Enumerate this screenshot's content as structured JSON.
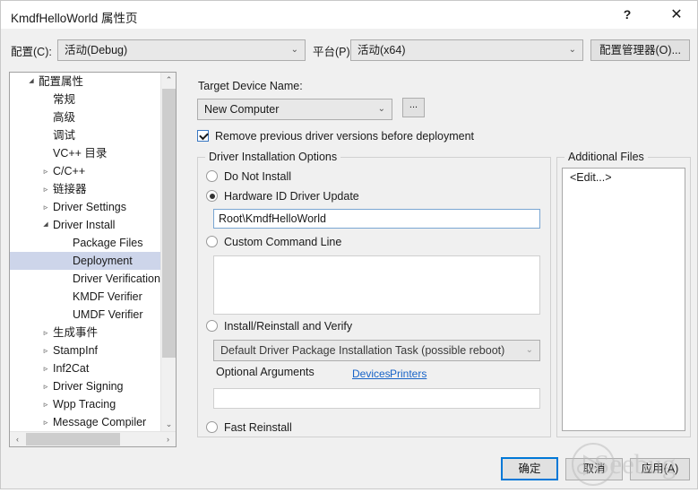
{
  "window": {
    "title": "KmdfHelloWorld 属性页",
    "help_label": "?",
    "close_label": "✕"
  },
  "config_bar": {
    "configuration_label": "配置(C):",
    "configuration_value": "活动(Debug)",
    "platform_label": "平台(P):",
    "platform_value": "活动(x64)",
    "config_manager_button": "配置管理器(O)...",
    "chevron": "⌄"
  },
  "tree": {
    "items": [
      {
        "label": "配置属性",
        "indent": 0,
        "arrow": "▲",
        "selected": false
      },
      {
        "label": "常规",
        "indent": 1,
        "arrow": "",
        "selected": false
      },
      {
        "label": "高级",
        "indent": 1,
        "arrow": "",
        "selected": false
      },
      {
        "label": "调试",
        "indent": 1,
        "arrow": "",
        "selected": false
      },
      {
        "label": "VC++ 目录",
        "indent": 1,
        "arrow": "",
        "selected": false
      },
      {
        "label": "C/C++",
        "indent": 1,
        "arrow": "▶",
        "selected": false
      },
      {
        "label": "链接器",
        "indent": 1,
        "arrow": "▶",
        "selected": false
      },
      {
        "label": "Driver Settings",
        "indent": 1,
        "arrow": "▶",
        "selected": false
      },
      {
        "label": "Driver Install",
        "indent": 1,
        "arrow": "▲",
        "selected": false
      },
      {
        "label": "Package Files",
        "indent": 2,
        "arrow": "",
        "selected": false
      },
      {
        "label": "Deployment",
        "indent": 2,
        "arrow": "",
        "selected": true
      },
      {
        "label": "Driver Verification",
        "indent": 2,
        "arrow": "",
        "selected": false
      },
      {
        "label": "KMDF Verifier",
        "indent": 2,
        "arrow": "",
        "selected": false
      },
      {
        "label": "UMDF Verifier",
        "indent": 2,
        "arrow": "",
        "selected": false
      },
      {
        "label": "生成事件",
        "indent": 1,
        "arrow": "▶",
        "selected": false
      },
      {
        "label": "StampInf",
        "indent": 1,
        "arrow": "▶",
        "selected": false
      },
      {
        "label": "Inf2Cat",
        "indent": 1,
        "arrow": "▶",
        "selected": false
      },
      {
        "label": "Driver Signing",
        "indent": 1,
        "arrow": "▶",
        "selected": false
      },
      {
        "label": "Wpp Tracing",
        "indent": 1,
        "arrow": "▶",
        "selected": false
      },
      {
        "label": "Message Compiler",
        "indent": 1,
        "arrow": "▶",
        "selected": false
      }
    ],
    "scroll_up": "⌃",
    "scroll_down": "⌄",
    "scroll_left": "‹",
    "scroll_right": "›"
  },
  "main": {
    "target_device_label": "Target Device Name:",
    "target_device_value": "New Computer",
    "target_device_chevron": "⌄",
    "browse_button": "...",
    "remove_previous_label": "Remove previous driver versions before deployment",
    "group_title": "Driver Installation Options",
    "option_do_not_install": "Do Not Install",
    "option_hardware_id": "Hardware ID Driver Update",
    "hardware_id_value": "Root\\KmdfHelloWorld",
    "option_custom_command": "Custom Command Line",
    "custom_command_value": "",
    "option_install_reinstall": "Install/Reinstall and Verify",
    "install_task_value": "Default Driver Package Installation Task (possible reboot)",
    "install_task_chevron": "⌄",
    "optional_arguments_label": "Optional Arguments",
    "link_devices": "Devices",
    "link_printers": "Printers",
    "optional_arguments_value": "",
    "option_fast_reinstall": "Fast Reinstall"
  },
  "additional_files": {
    "group_title": "Additional Files",
    "items": [
      "<Edit...>"
    ]
  },
  "footer": {
    "ok_label": "确定",
    "cancel_label": "取消",
    "apply_label": "应用(A)"
  },
  "watermark": {
    "text": "Seebug"
  }
}
